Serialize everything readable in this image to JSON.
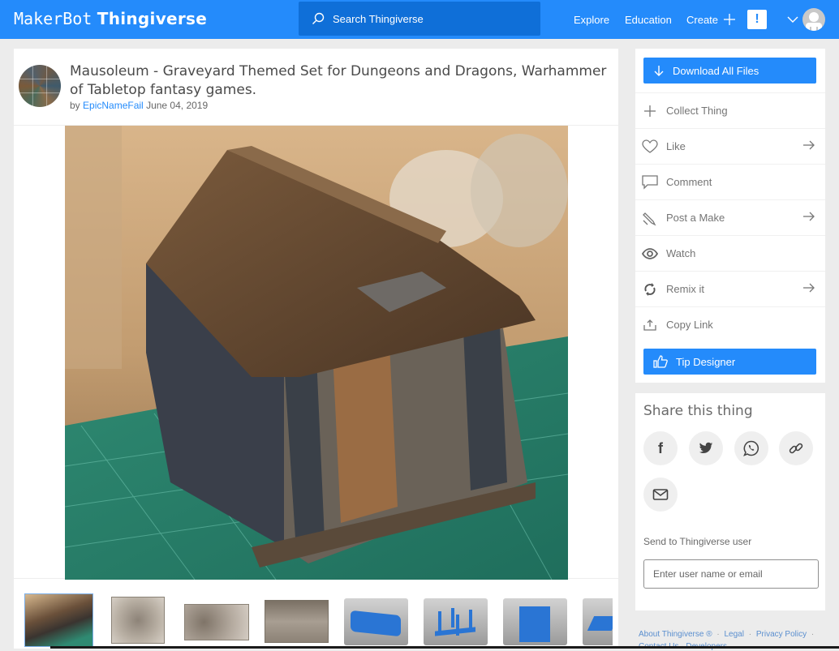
{
  "header": {
    "logo_left": "MakerBot",
    "logo_right": "Thingiverse",
    "search_placeholder": "Search Thingiverse",
    "nav": [
      {
        "label": "Explore"
      },
      {
        "label": "Education"
      },
      {
        "label": "Create"
      }
    ],
    "alert_glyph": "!",
    "brand_color": "#248bfb"
  },
  "thing": {
    "title": "Mausoleum - Graveyard Themed Set for Dungeons and Dragons, Warhammer of Tabletop fantasy games.",
    "by_label": "by",
    "author": "EpicNameFail",
    "date": "June 04, 2019",
    "thumbnails": [
      {
        "kind": "photo",
        "active": true
      },
      {
        "kind": "sketch",
        "active": false
      },
      {
        "kind": "sketch",
        "active": false
      },
      {
        "kind": "sketch",
        "active": false
      },
      {
        "kind": "render",
        "active": false
      },
      {
        "kind": "render",
        "active": false
      },
      {
        "kind": "render",
        "active": false
      },
      {
        "kind": "render",
        "active": false
      }
    ]
  },
  "actions": {
    "download_label": "Download All Files",
    "items": [
      {
        "label": "Collect Thing",
        "icon": "plus-icon",
        "has_arrow": false
      },
      {
        "label": "Like",
        "icon": "heart-icon",
        "has_arrow": true
      },
      {
        "label": "Comment",
        "icon": "comment-icon",
        "has_arrow": false
      },
      {
        "label": "Post a Make",
        "icon": "post-make-icon",
        "has_arrow": true
      },
      {
        "label": "Watch",
        "icon": "eye-icon",
        "has_arrow": false
      },
      {
        "label": "Remix it",
        "icon": "remix-icon",
        "has_arrow": true
      },
      {
        "label": "Copy Link",
        "icon": "share-upload-icon",
        "has_arrow": false
      }
    ],
    "tip_label": "Tip Designer"
  },
  "share": {
    "title": "Share this thing",
    "buttons": [
      {
        "name": "facebook",
        "glyph": "f"
      },
      {
        "name": "twitter"
      },
      {
        "name": "whatsapp"
      },
      {
        "name": "link"
      },
      {
        "name": "email"
      }
    ],
    "send_label": "Send to Thingiverse user",
    "send_placeholder": "Enter user name or email"
  },
  "footer": {
    "links": [
      "About Thingiverse ®",
      "Legal",
      "Privacy Policy"
    ],
    "links_row2": [
      "Contact Us",
      "Developers"
    ],
    "separator": "·"
  }
}
